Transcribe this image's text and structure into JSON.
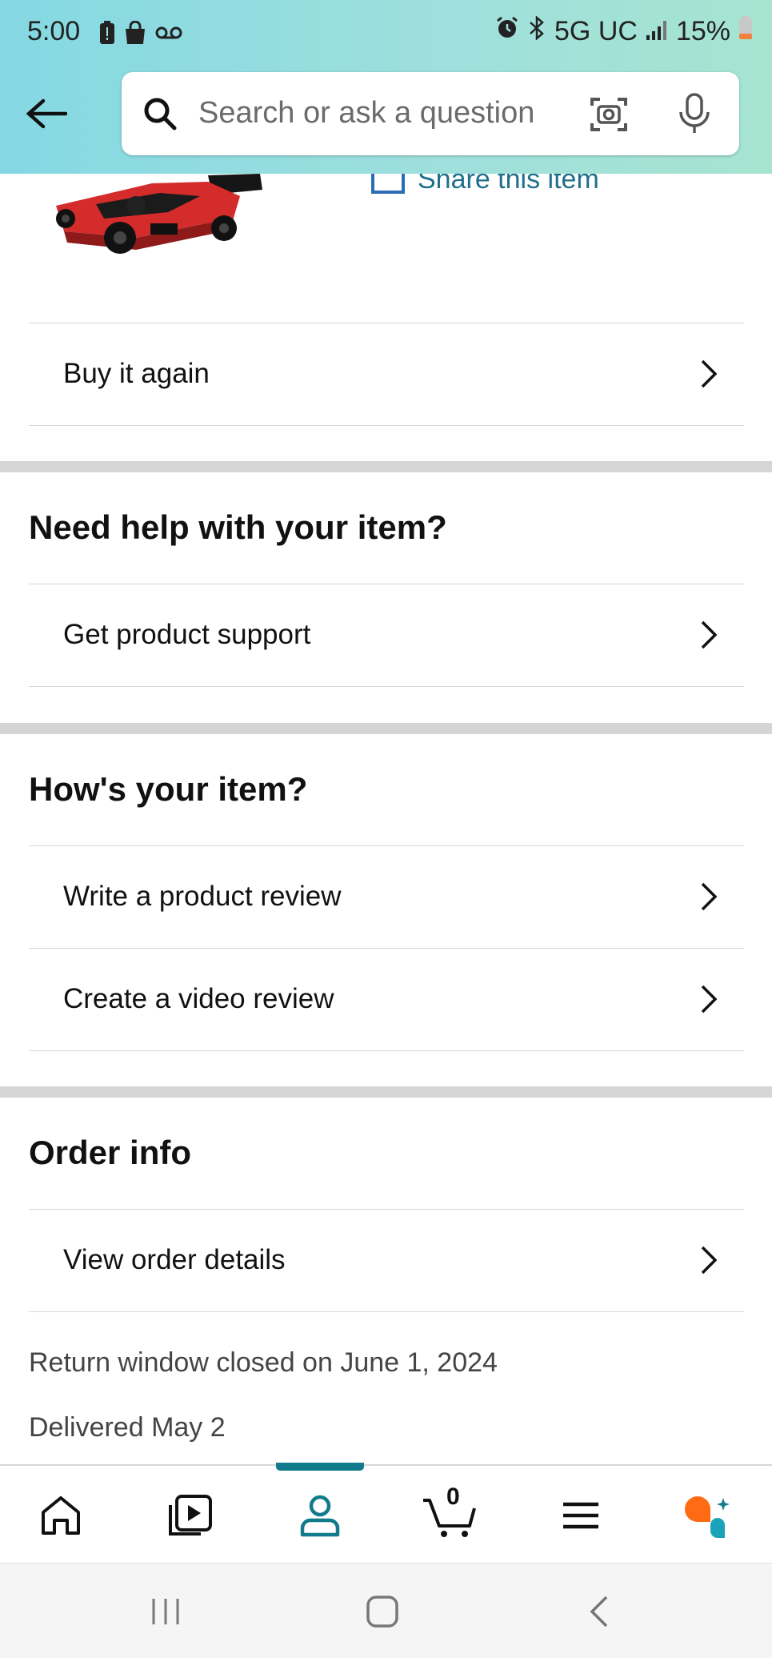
{
  "status_bar": {
    "time": "5:00",
    "network": "5G UC",
    "battery": "15%"
  },
  "search": {
    "placeholder": "Search or ask a question"
  },
  "item": {
    "share_label": "Share this item"
  },
  "rows": {
    "buy_again": "Buy it again",
    "product_support": "Get product support",
    "write_review": "Write a product review",
    "video_review": "Create a video review",
    "order_details": "View order details"
  },
  "sections": {
    "need_help": "Need help with your item?",
    "hows_item": "How's your item?",
    "order_info": "Order info"
  },
  "order": {
    "return_window": "Return window closed on June 1, 2024",
    "delivered": "Delivered May 2"
  },
  "bottom_nav": {
    "cart_count": "0",
    "active_tab": "account"
  },
  "colors": {
    "accent": "#117a8b",
    "link": "#1f6f8b",
    "ai_orange": "#ff6a13"
  }
}
